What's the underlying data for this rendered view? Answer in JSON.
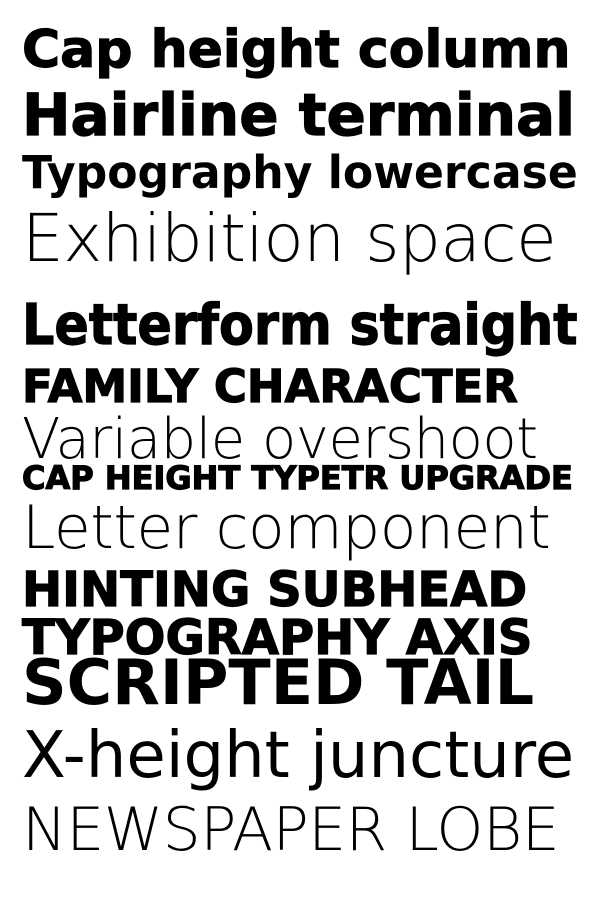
{
  "specimen": {
    "lines": [
      {
        "text": "Cap height column",
        "weight": 900
      },
      {
        "text": "Hairline terminal",
        "weight": 900
      },
      {
        "text": "Typography lowercase",
        "weight": 700
      },
      {
        "text": "Exhibition space",
        "weight": 100
      },
      {
        "text": "Letterform straight",
        "weight": 900
      },
      {
        "text": "FAMILY CHARACTER",
        "weight": 900
      },
      {
        "text": "Variable overshoot",
        "weight": 200
      },
      {
        "text": "CAP HEIGHT TYPETR UPGRADE",
        "weight": 900
      },
      {
        "text": "Letter component",
        "weight": 100
      },
      {
        "text": "HINTING SUBHEAD",
        "weight": 900
      },
      {
        "text": "TYPOGRAPHY AXIS",
        "weight": 900
      },
      {
        "text": "SCRIPTED TAIL",
        "weight": 700
      },
      {
        "text": "X-height juncture",
        "weight": 300
      },
      {
        "text": "NEWSPAPER LOBE",
        "weight": 100
      }
    ],
    "text_color": "#000000",
    "background_color": "#ffffff"
  }
}
